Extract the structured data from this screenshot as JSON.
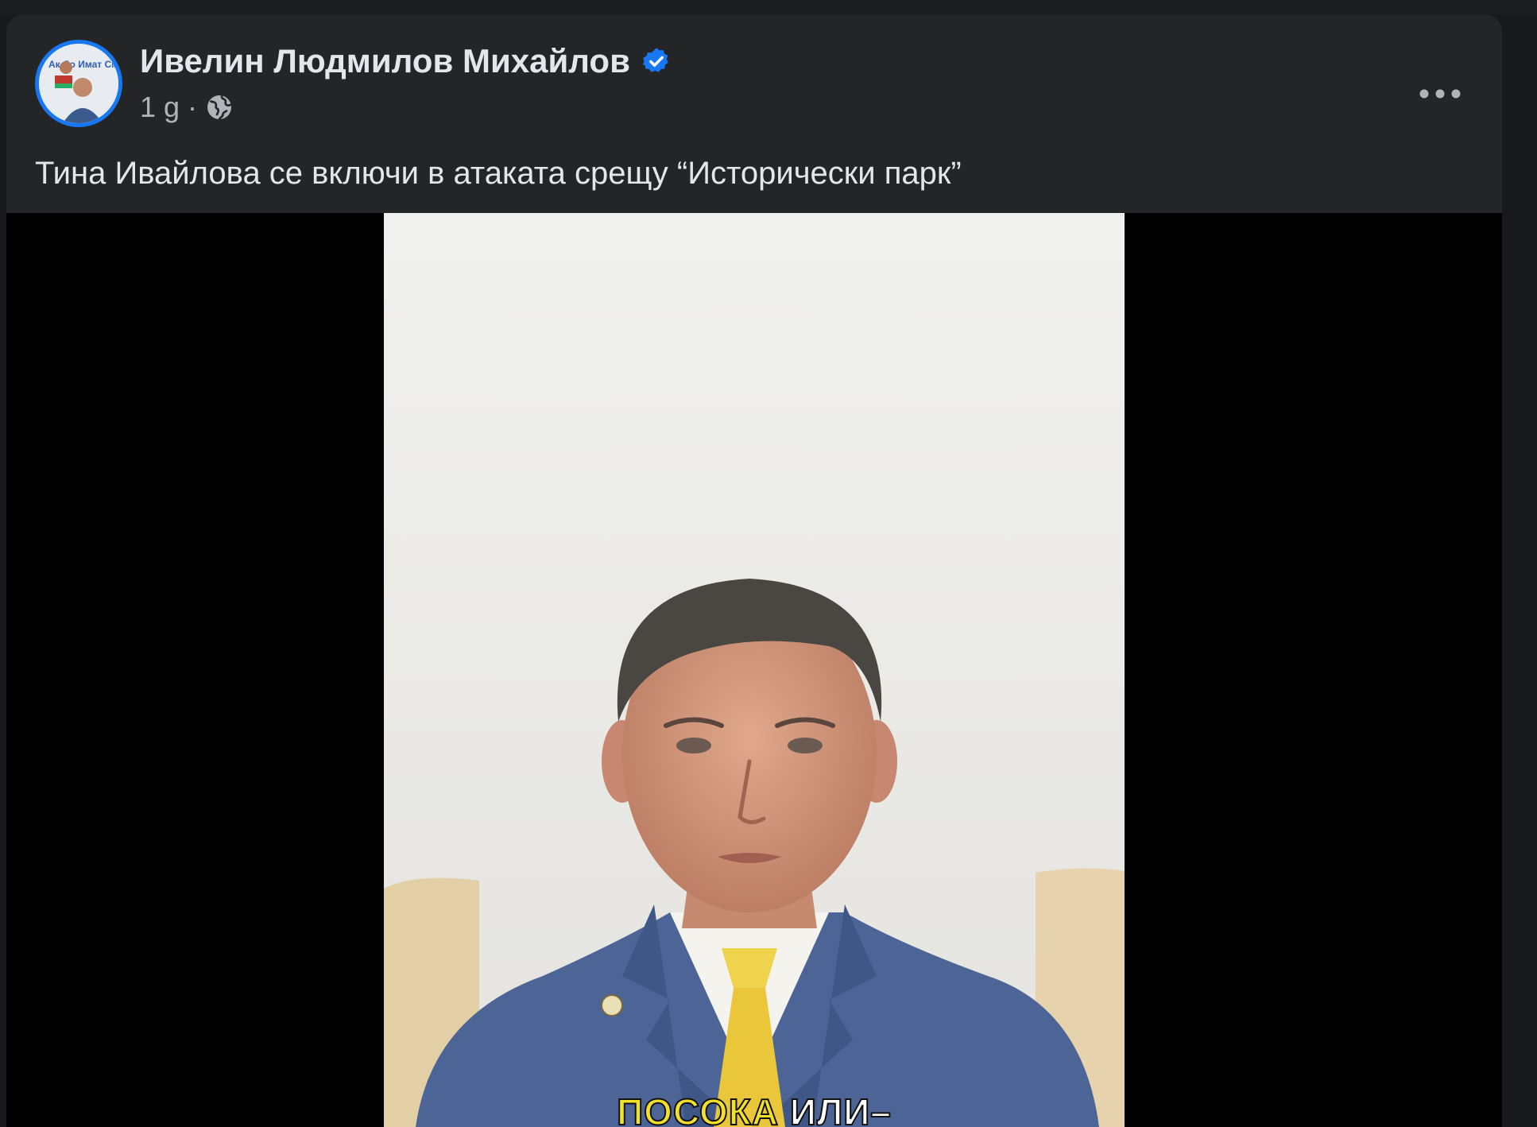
{
  "post": {
    "author_name": "Ивелин Людмилов Михайлов",
    "verified": true,
    "timestamp": "1 g",
    "separator": "·",
    "privacy_icon": "globe-icon",
    "more_icon": "more-horizontal-icon",
    "caption": "Тина Ивайлова се включи в атаката срещу “Исторически парк”",
    "avatar_text": "Ак Дo Имат Смени?"
  },
  "video": {
    "subtitle_highlight": "ПОСОКА",
    "subtitle_rest": " ИЛИ–"
  },
  "colors": {
    "background": "#18191a",
    "card": "#242526",
    "text_primary": "#e4e6eb",
    "text_secondary": "#b0b3b8",
    "verified_blue": "#1877f2",
    "subtitle_yellow": "#f2e12a"
  }
}
